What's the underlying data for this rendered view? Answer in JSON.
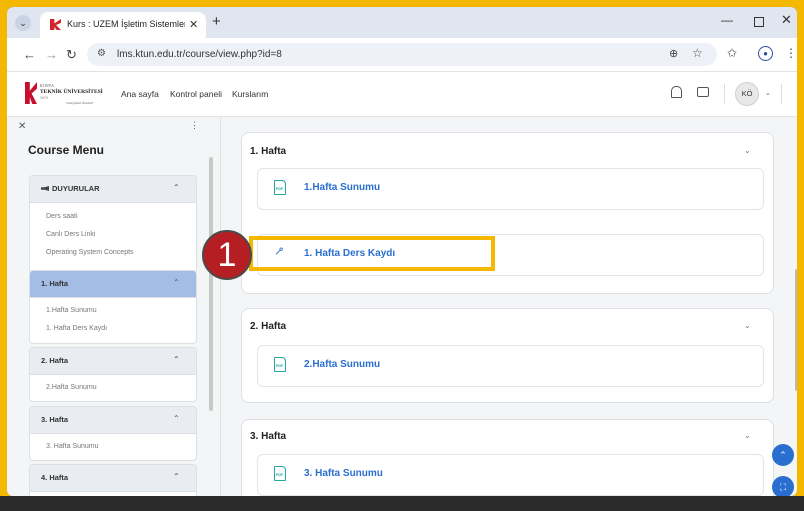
{
  "browser": {
    "tab_title": "Kurs : UZEM İşletim Sistemleri (",
    "url": "lms.ktun.edu.tr/course/view.php?id=8"
  },
  "site": {
    "logo_line1": "KONYA",
    "logo_line2": "TEKNİK ÜNİVERSİTESİ",
    "logo_line3": "1970",
    "logo_tagline": "\"Geleğinizi Öncüsü\"",
    "nav": [
      "Ana sayfa",
      "Kontrol paneli",
      "Kurslarım"
    ],
    "user_initials": "KÖ"
  },
  "drawer": {
    "title": "Course Menu",
    "sections": [
      {
        "label": "DUYURULAR",
        "items": [
          "Ders saati",
          "Canlı Ders Linki",
          "Operating System Concepts"
        ]
      },
      {
        "label": "1. Hafta",
        "active": true,
        "items": [
          "1.Hafta Sunumu",
          "1. Hafta Ders Kaydı"
        ]
      },
      {
        "label": "2. Hafta",
        "items": [
          "2.Hafta Sunumu"
        ]
      },
      {
        "label": "3. Hafta",
        "items": [
          "3. Hafta Sunumu"
        ]
      },
      {
        "label": "4. Hafta",
        "items": []
      }
    ]
  },
  "main": {
    "sections": [
      {
        "title": "1. Hafta",
        "activities": [
          {
            "name": "1.Hafta Sunumu",
            "type": "pdf"
          },
          {
            "name": "1. Hafta Ders Kaydı",
            "type": "url"
          }
        ]
      },
      {
        "title": "2. Hafta",
        "activities": [
          {
            "name": "2.Hafta Sunumu",
            "type": "pdf"
          }
        ]
      },
      {
        "title": "3. Hafta",
        "activities": [
          {
            "name": "3. Hafta Sunumu",
            "type": "pdf"
          }
        ]
      }
    ]
  },
  "annotation": {
    "step_number": "1",
    "accent_color": "#f5b800",
    "badge_color": "#b51f24"
  },
  "colors": {
    "link": "#2a6fd0",
    "active_section": "#a3bde6"
  }
}
